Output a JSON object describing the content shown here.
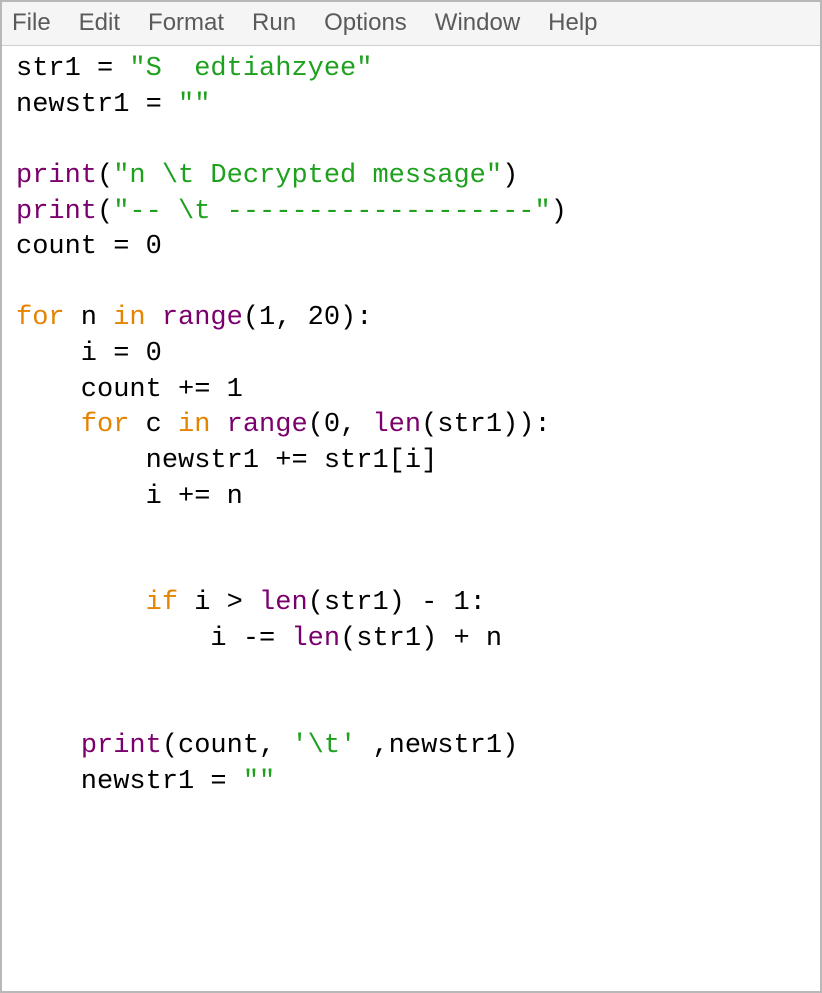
{
  "menubar": {
    "items": [
      "File",
      "Edit",
      "Format",
      "Run",
      "Options",
      "Window",
      "Help"
    ]
  },
  "code": {
    "lines": [
      [
        {
          "t": "str1 = ",
          "c": ""
        },
        {
          "t": "\"S  edtiahzyee\"",
          "c": "tok-str"
        }
      ],
      [
        {
          "t": "newstr1 = ",
          "c": ""
        },
        {
          "t": "\"\"",
          "c": "tok-str"
        }
      ],
      [
        {
          "t": "",
          "c": ""
        }
      ],
      [
        {
          "t": "print",
          "c": "tok-bltn"
        },
        {
          "t": "(",
          "c": ""
        },
        {
          "t": "\"n \\t Decrypted message\"",
          "c": "tok-str"
        },
        {
          "t": ")",
          "c": ""
        }
      ],
      [
        {
          "t": "print",
          "c": "tok-bltn"
        },
        {
          "t": "(",
          "c": ""
        },
        {
          "t": "\"-- \\t -------------------\"",
          "c": "tok-str"
        },
        {
          "t": ")",
          "c": ""
        }
      ],
      [
        {
          "t": "count = 0",
          "c": ""
        }
      ],
      [
        {
          "t": "",
          "c": ""
        }
      ],
      [
        {
          "t": "for",
          "c": "tok-kw"
        },
        {
          "t": " n ",
          "c": ""
        },
        {
          "t": "in",
          "c": "tok-kw"
        },
        {
          "t": " ",
          "c": ""
        },
        {
          "t": "range",
          "c": "tok-bltn"
        },
        {
          "t": "(1, 20):",
          "c": ""
        }
      ],
      [
        {
          "t": "    i = 0",
          "c": ""
        }
      ],
      [
        {
          "t": "    count += 1",
          "c": ""
        }
      ],
      [
        {
          "t": "    ",
          "c": ""
        },
        {
          "t": "for",
          "c": "tok-kw"
        },
        {
          "t": " c ",
          "c": ""
        },
        {
          "t": "in",
          "c": "tok-kw"
        },
        {
          "t": " ",
          "c": ""
        },
        {
          "t": "range",
          "c": "tok-bltn"
        },
        {
          "t": "(0, ",
          "c": ""
        },
        {
          "t": "len",
          "c": "tok-bltn"
        },
        {
          "t": "(str1)):",
          "c": ""
        }
      ],
      [
        {
          "t": "        newstr1 += str1[i]",
          "c": ""
        }
      ],
      [
        {
          "t": "        i += n",
          "c": ""
        }
      ],
      [
        {
          "t": "",
          "c": ""
        }
      ],
      [
        {
          "t": "",
          "c": ""
        }
      ],
      [
        {
          "t": "        ",
          "c": ""
        },
        {
          "t": "if",
          "c": "tok-kw"
        },
        {
          "t": " i > ",
          "c": ""
        },
        {
          "t": "len",
          "c": "tok-bltn"
        },
        {
          "t": "(str1) - 1:",
          "c": ""
        }
      ],
      [
        {
          "t": "            i -= ",
          "c": ""
        },
        {
          "t": "len",
          "c": "tok-bltn"
        },
        {
          "t": "(str1) + n",
          "c": ""
        }
      ],
      [
        {
          "t": "",
          "c": ""
        }
      ],
      [
        {
          "t": "",
          "c": ""
        }
      ],
      [
        {
          "t": "    ",
          "c": ""
        },
        {
          "t": "print",
          "c": "tok-bltn"
        },
        {
          "t": "(count, ",
          "c": ""
        },
        {
          "t": "'\\t'",
          "c": "tok-str"
        },
        {
          "t": " ,newstr1)",
          "c": ""
        }
      ],
      [
        {
          "t": "    newstr1 = ",
          "c": ""
        },
        {
          "t": "\"\"",
          "c": "tok-str"
        }
      ]
    ]
  }
}
